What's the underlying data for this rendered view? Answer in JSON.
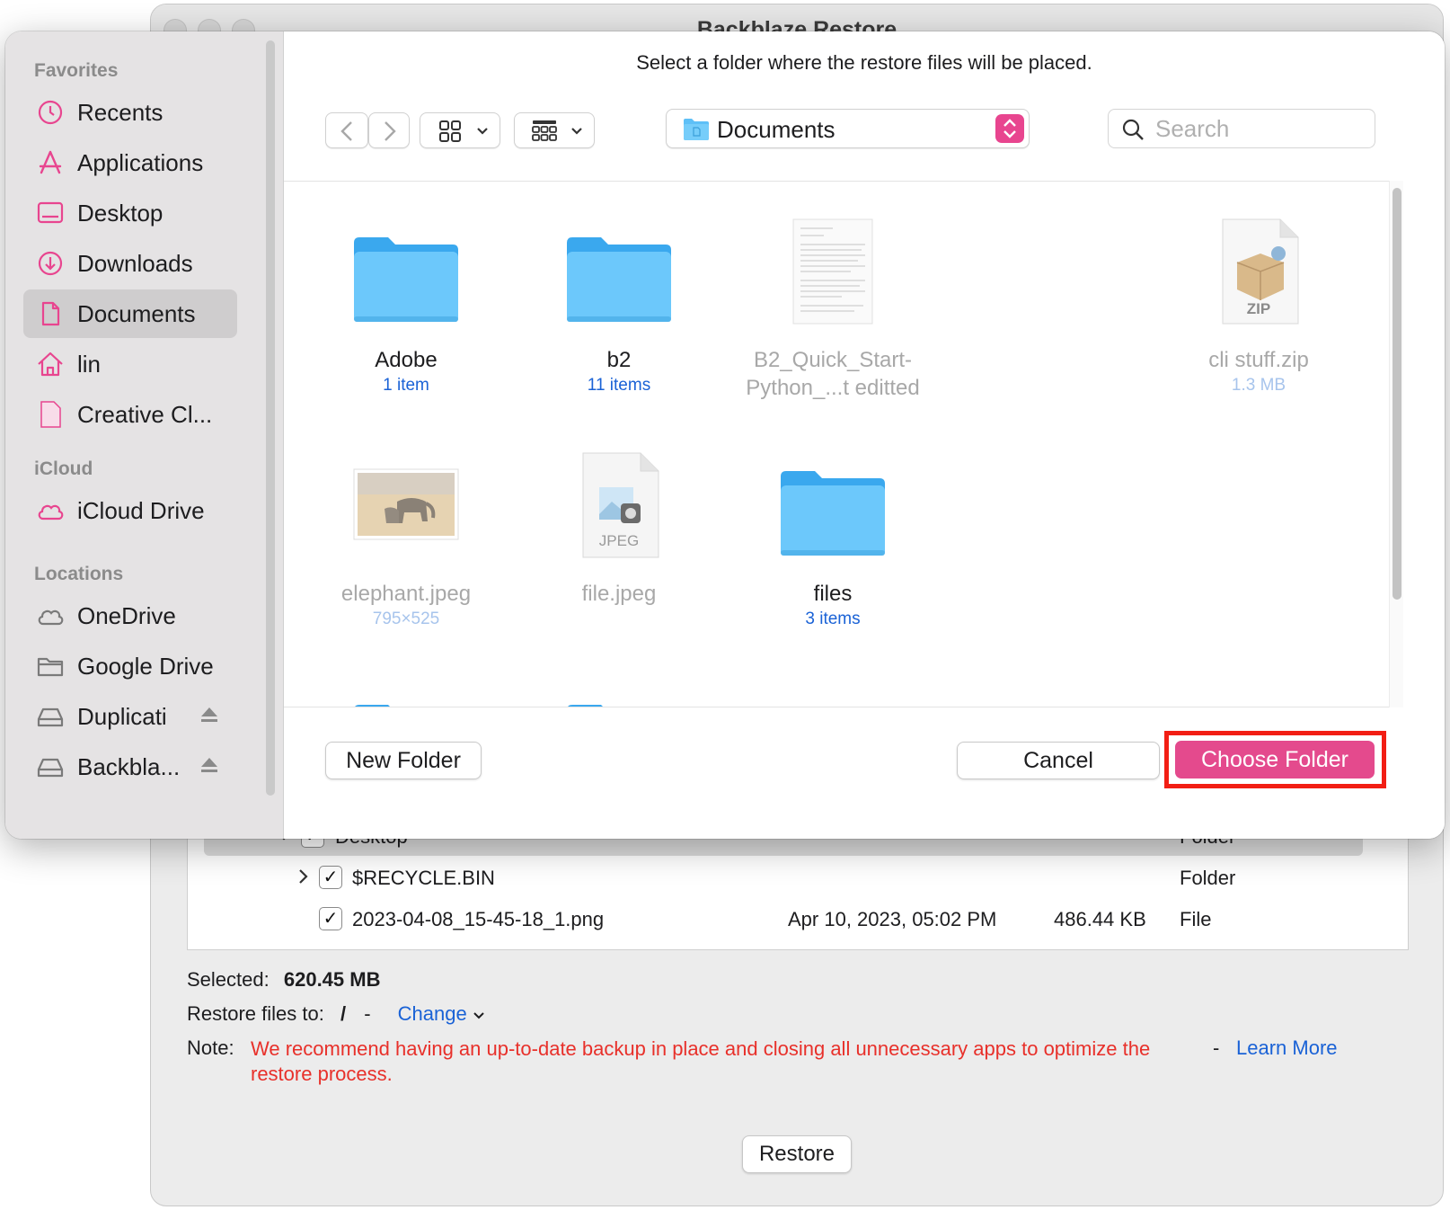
{
  "bg_window": {
    "title": "Backblaze Restore",
    "rows": [
      {
        "name": "Desktop",
        "kind": "Folder"
      },
      {
        "name": "$RECYCLE.BIN",
        "kind": "Folder"
      },
      {
        "name": "2023-04-08_15-45-18_1.png",
        "date": "Apr 10, 2023, 05:02 PM",
        "size": "486.44 KB",
        "kind": "File"
      }
    ],
    "selected_label": "Selected:",
    "selected_value": "620.45 MB",
    "restore_label": "Restore files to:",
    "restore_path": "/",
    "restore_sep": "-",
    "change_link": "Change",
    "note_label": "Note:",
    "note_text": "We recommend having an up-to-date backup in place and closing all unnecessary apps to optimize the restore process.",
    "note_sep": "-",
    "learn_more": "Learn More",
    "restore_button": "Restore"
  },
  "dialog": {
    "prompt": "Select a folder where the restore files will be placed.",
    "location": "Documents",
    "search_placeholder": "Search",
    "sidebar": {
      "favorites_heading": "Favorites",
      "favorites": [
        "Recents",
        "Applications",
        "Desktop",
        "Downloads",
        "Documents",
        "lin",
        "Creative Cl..."
      ],
      "icloud_heading": "iCloud",
      "icloud": [
        "iCloud Drive"
      ],
      "locations_heading": "Locations",
      "locations": [
        "OneDrive",
        "Google Drive",
        "Duplicati",
        "Backbla..."
      ]
    },
    "files": [
      {
        "name": "Adobe",
        "sub": "1 item"
      },
      {
        "name": "b2",
        "sub": "11 items"
      },
      {
        "name": "B2_Quick_Start-",
        "name2": "Python_...t editted"
      },
      {
        "name": "cli stuff.zip",
        "sub": "1.3 MB"
      },
      {
        "name": "elephant.jpeg",
        "sub": "795×525"
      },
      {
        "name": "file.jpeg"
      },
      {
        "name": "files",
        "sub": "3 items"
      }
    ],
    "zip_badge": "ZIP",
    "jpeg_badge": "JPEG",
    "new_folder": "New Folder",
    "cancel": "Cancel",
    "choose_folder": "Choose Folder"
  },
  "colors": {
    "accent_pink": "#e8458f",
    "folder_blue": "#5ec0f7",
    "link_blue": "#1a62d6",
    "warning_red": "#e8302a",
    "highlight_red": "#f21e14"
  },
  "icons": {
    "recents": "clock-icon",
    "applications": "app-store-icon",
    "desktop": "desktop-icon",
    "downloads": "download-icon",
    "documents": "document-icon",
    "home": "house-icon",
    "creative_cloud": "file-icon",
    "icloud": "cloud-icon",
    "onedrive": "cloud-icon",
    "google_drive": "folder-icon",
    "drive": "external-drive-icon",
    "eject": "eject-icon"
  }
}
